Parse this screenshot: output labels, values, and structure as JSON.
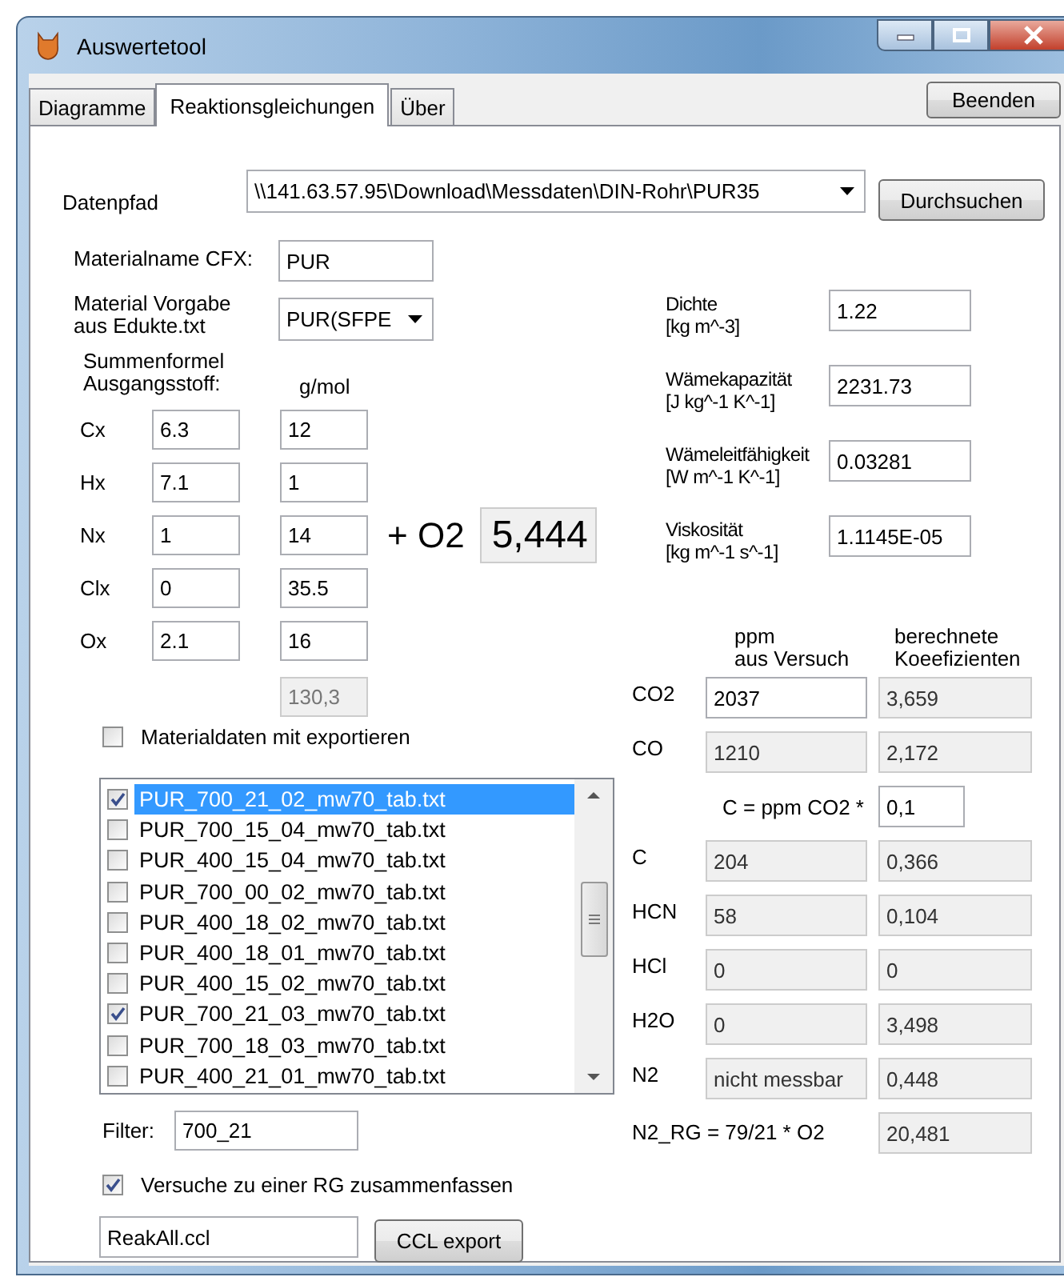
{
  "window": {
    "title": "Auswertetool"
  },
  "tabs": [
    {
      "label": "Diagramme",
      "selected": false
    },
    {
      "label": "Reaktionsgleichungen",
      "selected": true
    },
    {
      "label": "Über",
      "selected": false
    }
  ],
  "quit_button": "Beenden",
  "data_path": {
    "label": "Datenpfad",
    "value": "\\\\141.63.57.95\\Download\\Messdaten\\DIN-Rohr\\PUR35"
  },
  "browse_button": "Durchsuchen",
  "material_name": {
    "label": "Materialname CFX:",
    "value": "PUR"
  },
  "material_preset": {
    "label": "Material Vorgabe\naus Edukte.txt",
    "value": "PUR(SFPE"
  },
  "formula": {
    "label": "Summenformel\nAusgangsstoff:",
    "unit_header": "g/mol",
    "total": "130,3",
    "rows": [
      {
        "label": "Cx",
        "count": "6.3",
        "molar_mass": "12"
      },
      {
        "label": "Hx",
        "count": "7.1",
        "molar_mass": "1"
      },
      {
        "label": "Nx",
        "count": "1",
        "molar_mass": "14"
      },
      {
        "label": "Clx",
        "count": "0",
        "molar_mass": "35.5"
      },
      {
        "label": "Ox",
        "count": "2.1",
        "molar_mass": "16"
      }
    ]
  },
  "oxygen": {
    "label": "+ O2",
    "value": "5,444"
  },
  "export_material": {
    "label": "Materialdaten mit exportieren",
    "checked": false
  },
  "files": [
    {
      "name": "PUR_700_21_02_mw70_tab.txt",
      "checked": true,
      "selected": true
    },
    {
      "name": "PUR_700_15_04_mw70_tab.txt",
      "checked": false,
      "selected": false
    },
    {
      "name": "PUR_400_15_04_mw70_tab.txt",
      "checked": false,
      "selected": false
    },
    {
      "name": "PUR_700_00_02_mw70_tab.txt",
      "checked": false,
      "selected": false
    },
    {
      "name": "PUR_400_18_02_mw70_tab.txt",
      "checked": false,
      "selected": false
    },
    {
      "name": "PUR_400_18_01_mw70_tab.txt",
      "checked": false,
      "selected": false
    },
    {
      "name": "PUR_400_15_02_mw70_tab.txt",
      "checked": false,
      "selected": false
    },
    {
      "name": "PUR_700_21_03_mw70_tab.txt",
      "checked": true,
      "selected": false
    },
    {
      "name": "PUR_700_18_03_mw70_tab.txt",
      "checked": false,
      "selected": false
    },
    {
      "name": "PUR_400_21_01_mw70_tab.txt",
      "checked": false,
      "selected": false
    }
  ],
  "filter": {
    "label": "Filter:",
    "value": "700_21"
  },
  "merge": {
    "label": "Versuche zu einer RG zusammenfassen",
    "checked": true
  },
  "output_file": {
    "value": "ReakAll.ccl"
  },
  "export_button": "CCL export",
  "properties": [
    {
      "label": "Dichte\n[kg m^-3]",
      "value": "1.22"
    },
    {
      "label": "Wämekapazität\n[J kg^-1 K^-1]",
      "value": "2231.73"
    },
    {
      "label": "Wämeleitfähigkeit\n[W m^-1 K^-1]",
      "value": "0.03281"
    },
    {
      "label": "Viskosität\n[kg m^-1 s^-1]",
      "value": "1.1145E-05"
    }
  ],
  "gases": {
    "header_measured": "ppm\naus Versuch",
    "header_computed": "berechnete\nKoeefizienten",
    "rows": [
      {
        "kind": "gas",
        "label": "CO2",
        "measured": "2037",
        "computed": "3,659",
        "editable": true
      },
      {
        "kind": "gas",
        "label": "CO",
        "measured": "1210",
        "computed": "2,172",
        "editable": false
      },
      {
        "kind": "factor",
        "label": "C = ppm CO2 *",
        "value": "0,1"
      },
      {
        "kind": "gas",
        "label": "C",
        "measured": "204",
        "computed": "0,366",
        "editable": false
      },
      {
        "kind": "gas",
        "label": "HCN",
        "measured": "58",
        "computed": "0,104",
        "editable": false
      },
      {
        "kind": "gas",
        "label": "HCl",
        "measured": "0",
        "computed": "0",
        "editable": false
      },
      {
        "kind": "gas",
        "label": "H2O",
        "measured": "0",
        "computed": "3,498",
        "editable": false
      },
      {
        "kind": "gas",
        "label": "N2",
        "measured": "nicht messbar",
        "computed": "0,448",
        "editable": false
      },
      {
        "kind": "total",
        "label": "N2_RG = 79/21 * O2",
        "computed": "20,481"
      }
    ]
  }
}
